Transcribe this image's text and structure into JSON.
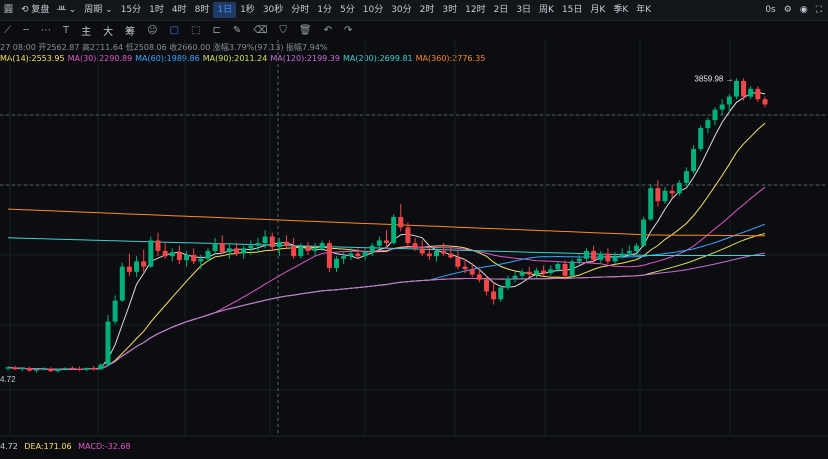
{
  "toolbar": {
    "leading": "圓",
    "adjust_label": "复盘",
    "chart_type_label": "",
    "period_label": "周期",
    "periods": [
      "15分",
      "1时",
      "4时",
      "8时",
      "1日",
      "1秒",
      "30秒",
      "分时",
      "1分",
      "5分",
      "10分",
      "30分",
      "2时",
      "3时",
      "12时",
      "2日",
      "3日",
      "周K",
      "15日",
      "月K",
      "季K",
      "年K"
    ],
    "active_period": "1日",
    "countdown": "0s"
  },
  "drawbar": {
    "icons": [
      "line-tool-icon",
      "horizontal-ray-icon",
      "dotted-line-icon",
      "text-tool-icon",
      "emoji-icon",
      "select-tool-icon",
      "shape-tool-icon",
      "measure-tool-icon",
      "pen-tool-icon",
      "erase-tool-icon",
      "filter-tool-icon",
      "trash-icon",
      "undo-icon",
      "redo-icon"
    ],
    "indicator_labels": [
      "主",
      "大",
      "筹"
    ]
  },
  "ohlc": {
    "date": "27 08:00",
    "open_label": "开",
    "open": "2562.87",
    "high_label": "高",
    "high": "2711.64",
    "low_label": "低",
    "low": "2508.06",
    "close_label": "收",
    "close": "2660.00",
    "change_label": "涨幅",
    "change": "3.79%(97.13)",
    "amplitude_label": "振幅",
    "amplitude": "7.94%"
  },
  "ma": [
    {
      "label": "MA(14):2553.95",
      "color": "#f7e05a"
    },
    {
      "label": "MA(30):2290.89",
      "color": "#e056c8"
    },
    {
      "label": "MA(60):1989.86",
      "color": "#36a8ff"
    },
    {
      "label": "MA(90):2011.24",
      "color": "#d6e35c"
    },
    {
      "label": "MA(120):2199.39",
      "color": "#c66fd6"
    },
    {
      "label": "MA(200):2699.81",
      "color": "#3fd0d0"
    },
    {
      "label": "MA(360):2776.35",
      "color": "#ff8a1f"
    }
  ],
  "chart_data": {
    "type": "candlestick",
    "price_top": 4000,
    "price_bottom": 1400,
    "max_label": "3859.98",
    "low_left_label": "4.72",
    "up_color": "#00b07c",
    "down_color": "#f0474b",
    "candles": [
      [
        1640,
        1655,
        1625,
        1650
      ],
      [
        1650,
        1660,
        1630,
        1635
      ],
      [
        1635,
        1650,
        1620,
        1645
      ],
      [
        1645,
        1655,
        1615,
        1625
      ],
      [
        1625,
        1640,
        1610,
        1635
      ],
      [
        1635,
        1650,
        1625,
        1640
      ],
      [
        1640,
        1650,
        1615,
        1620
      ],
      [
        1620,
        1640,
        1610,
        1635
      ],
      [
        1635,
        1650,
        1625,
        1645
      ],
      [
        1645,
        1660,
        1630,
        1640
      ],
      [
        1640,
        1655,
        1620,
        1630
      ],
      [
        1630,
        1650,
        1620,
        1645
      ],
      [
        1645,
        1660,
        1625,
        1635
      ],
      [
        1635,
        1680,
        1630,
        1670
      ],
      [
        1670,
        2050,
        1660,
        2000
      ],
      [
        2000,
        2200,
        1980,
        2160
      ],
      [
        2160,
        2450,
        2150,
        2420
      ],
      [
        2420,
        2520,
        2350,
        2380
      ],
      [
        2380,
        2500,
        2340,
        2460
      ],
      [
        2460,
        2550,
        2380,
        2420
      ],
      [
        2420,
        2650,
        2410,
        2620
      ],
      [
        2620,
        2680,
        2500,
        2540
      ],
      [
        2540,
        2600,
        2480,
        2500
      ],
      [
        2500,
        2560,
        2460,
        2530
      ],
      [
        2530,
        2580,
        2440,
        2470
      ],
      [
        2470,
        2540,
        2420,
        2510
      ],
      [
        2510,
        2560,
        2440,
        2460
      ],
      [
        2460,
        2510,
        2400,
        2480
      ],
      [
        2480,
        2560,
        2460,
        2540
      ],
      [
        2540,
        2640,
        2510,
        2600
      ],
      [
        2600,
        2660,
        2520,
        2530
      ],
      [
        2530,
        2590,
        2480,
        2560
      ],
      [
        2560,
        2600,
        2500,
        2520
      ],
      [
        2520,
        2580,
        2480,
        2560
      ],
      [
        2560,
        2620,
        2510,
        2580
      ],
      [
        2580,
        2640,
        2530,
        2600
      ],
      [
        2600,
        2700,
        2560,
        2650
      ],
      [
        2650,
        2680,
        2540,
        2570
      ],
      [
        2570,
        2640,
        2500,
        2610
      ],
      [
        2610,
        2660,
        2560,
        2580
      ],
      [
        2580,
        2640,
        2480,
        2500
      ],
      [
        2500,
        2600,
        2480,
        2570
      ],
      [
        2570,
        2610,
        2510,
        2540
      ],
      [
        2540,
        2600,
        2500,
        2560
      ],
      [
        2560,
        2620,
        2540,
        2600
      ],
      [
        2600,
        2620,
        2380,
        2410
      ],
      [
        2410,
        2500,
        2380,
        2480
      ],
      [
        2480,
        2530,
        2440,
        2500
      ],
      [
        2500,
        2560,
        2470,
        2520
      ],
      [
        2520,
        2560,
        2480,
        2500
      ],
      [
        2500,
        2560,
        2470,
        2530
      ],
      [
        2530,
        2600,
        2500,
        2580
      ],
      [
        2580,
        2650,
        2560,
        2620
      ],
      [
        2620,
        2700,
        2560,
        2600
      ],
      [
        2600,
        2820,
        2590,
        2800
      ],
      [
        2800,
        2900,
        2690,
        2720
      ],
      [
        2720,
        2760,
        2580,
        2600
      ],
      [
        2600,
        2640,
        2540,
        2560
      ],
      [
        2560,
        2620,
        2500,
        2520
      ],
      [
        2520,
        2580,
        2470,
        2500
      ],
      [
        2500,
        2560,
        2460,
        2540
      ],
      [
        2540,
        2600,
        2500,
        2520
      ],
      [
        2520,
        2580,
        2480,
        2490
      ],
      [
        2490,
        2540,
        2400,
        2420
      ],
      [
        2420,
        2480,
        2370,
        2400
      ],
      [
        2400,
        2450,
        2340,
        2360
      ],
      [
        2360,
        2410,
        2300,
        2320
      ],
      [
        2320,
        2350,
        2200,
        2230
      ],
      [
        2230,
        2300,
        2130,
        2170
      ],
      [
        2170,
        2280,
        2150,
        2260
      ],
      [
        2260,
        2350,
        2240,
        2330
      ],
      [
        2330,
        2380,
        2300,
        2350
      ],
      [
        2350,
        2400,
        2320,
        2380
      ],
      [
        2380,
        2420,
        2340,
        2360
      ],
      [
        2360,
        2410,
        2330,
        2390
      ],
      [
        2390,
        2430,
        2350,
        2370
      ],
      [
        2370,
        2430,
        2350,
        2400
      ],
      [
        2400,
        2460,
        2380,
        2440
      ],
      [
        2440,
        2470,
        2320,
        2350
      ],
      [
        2350,
        2480,
        2340,
        2460
      ],
      [
        2460,
        2510,
        2430,
        2480
      ],
      [
        2480,
        2560,
        2460,
        2540
      ],
      [
        2540,
        2580,
        2450,
        2470
      ],
      [
        2470,
        2540,
        2450,
        2520
      ],
      [
        2520,
        2560,
        2440,
        2460
      ],
      [
        2460,
        2530,
        2440,
        2500
      ],
      [
        2500,
        2560,
        2480,
        2520
      ],
      [
        2520,
        2580,
        2500,
        2540
      ],
      [
        2540,
        2600,
        2520,
        2580
      ],
      [
        2580,
        2800,
        2570,
        2780
      ],
      [
        2780,
        3050,
        2770,
        3020
      ],
      [
        3020,
        3080,
        2880,
        2920
      ],
      [
        2920,
        3030,
        2900,
        3000
      ],
      [
        3000,
        3040,
        2940,
        2980
      ],
      [
        2980,
        3080,
        2960,
        3060
      ],
      [
        3060,
        3180,
        3040,
        3150
      ],
      [
        3150,
        3350,
        3130,
        3320
      ],
      [
        3320,
        3500,
        3300,
        3480
      ],
      [
        3480,
        3560,
        3440,
        3540
      ],
      [
        3540,
        3640,
        3500,
        3620
      ],
      [
        3620,
        3700,
        3580,
        3660
      ],
      [
        3660,
        3740,
        3600,
        3720
      ],
      [
        3720,
        3860,
        3700,
        3840
      ],
      [
        3840,
        3860,
        3690,
        3720
      ],
      [
        3720,
        3800,
        3700,
        3780
      ],
      [
        3780,
        3800,
        3680,
        3700
      ],
      [
        3700,
        3720,
        3640,
        3660
      ]
    ]
  },
  "macd": {
    "value": "4.72",
    "dea": "DEA:171.06",
    "macd_label": "MACD:-32.68",
    "value_color": "#c8ccd4",
    "dea_color": "#f7e05a",
    "macd_color": "#e056c8"
  }
}
